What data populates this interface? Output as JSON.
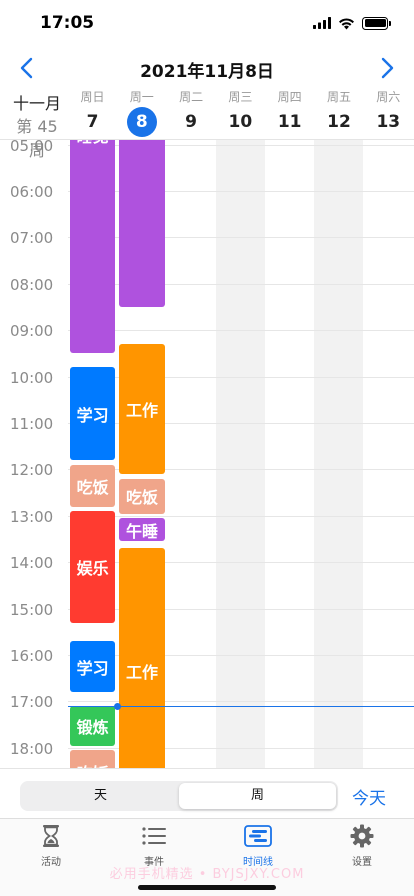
{
  "status_bar": {
    "time": "17:05"
  },
  "header": {
    "title": "2021年11月8日",
    "prev_icon": "chevron-left-icon",
    "next_icon": "chevron-right-icon"
  },
  "week": {
    "month": "十一月",
    "week_number": "第 45 周",
    "days": [
      {
        "name": "周日",
        "num": "7",
        "today": false
      },
      {
        "name": "周一",
        "num": "8",
        "today": true
      },
      {
        "name": "周二",
        "num": "9",
        "today": false
      },
      {
        "name": "周三",
        "num": "10",
        "today": false
      },
      {
        "name": "周四",
        "num": "11",
        "today": false
      },
      {
        "name": "周五",
        "num": "12",
        "today": false
      },
      {
        "name": "周六",
        "num": "13",
        "today": false
      }
    ]
  },
  "timeline": {
    "visible_start_hour": 4.9,
    "hours": [
      "05:00",
      "06:00",
      "07:00",
      "08:00",
      "09:00",
      "10:00",
      "11:00",
      "12:00",
      "13:00",
      "14:00",
      "15:00",
      "16:00",
      "17:00",
      "18:00"
    ],
    "now_hour": 17.09,
    "events": [
      {
        "day": 0,
        "label": "睡觉",
        "start": 4.5,
        "end": 9.5,
        "color": "#af52de",
        "label_top": true
      },
      {
        "day": 0,
        "label": "学习",
        "start": 9.8,
        "end": 11.8,
        "color": "#007aff"
      },
      {
        "day": 0,
        "label": "吃饭",
        "start": 11.9,
        "end": 12.8,
        "color": "#f0a58a"
      },
      {
        "day": 0,
        "label": "娱乐",
        "start": 12.9,
        "end": 15.3,
        "color": "#ff3b30"
      },
      {
        "day": 0,
        "label": "学习",
        "start": 15.7,
        "end": 16.8,
        "color": "#007aff"
      },
      {
        "day": 0,
        "label": "锻炼",
        "start": 17.1,
        "end": 17.95,
        "color": "#34c759"
      },
      {
        "day": 0,
        "label": "吃饭",
        "start": 18.05,
        "end": 19.0,
        "color": "#f0a58a"
      },
      {
        "day": 1,
        "label": "",
        "start": 4.5,
        "end": 8.5,
        "color": "#af52de"
      },
      {
        "day": 1,
        "label": "工作",
        "start": 9.3,
        "end": 12.1,
        "color": "#ff9500"
      },
      {
        "day": 1,
        "label": "吃饭",
        "start": 12.2,
        "end": 12.95,
        "color": "#f0a58a"
      },
      {
        "day": 1,
        "label": "午睡",
        "start": 13.05,
        "end": 13.55,
        "color": "#af52de"
      },
      {
        "day": 1,
        "label": "工作",
        "start": 13.7,
        "end": 19.0,
        "color": "#ff9500"
      }
    ]
  },
  "view_switch": {
    "day_label": "天",
    "week_label": "周",
    "selected": "week",
    "today_label": "今天"
  },
  "tabs": [
    {
      "label": "活动",
      "icon": "hourglass-icon",
      "active": false
    },
    {
      "label": "事件",
      "icon": "list-icon",
      "active": false
    },
    {
      "label": "时间线",
      "icon": "timeline-icon",
      "active": true
    },
    {
      "label": "设置",
      "icon": "gear-icon",
      "active": false
    }
  ],
  "watermark": "必用手机精选 • BYJSJXY.COM"
}
